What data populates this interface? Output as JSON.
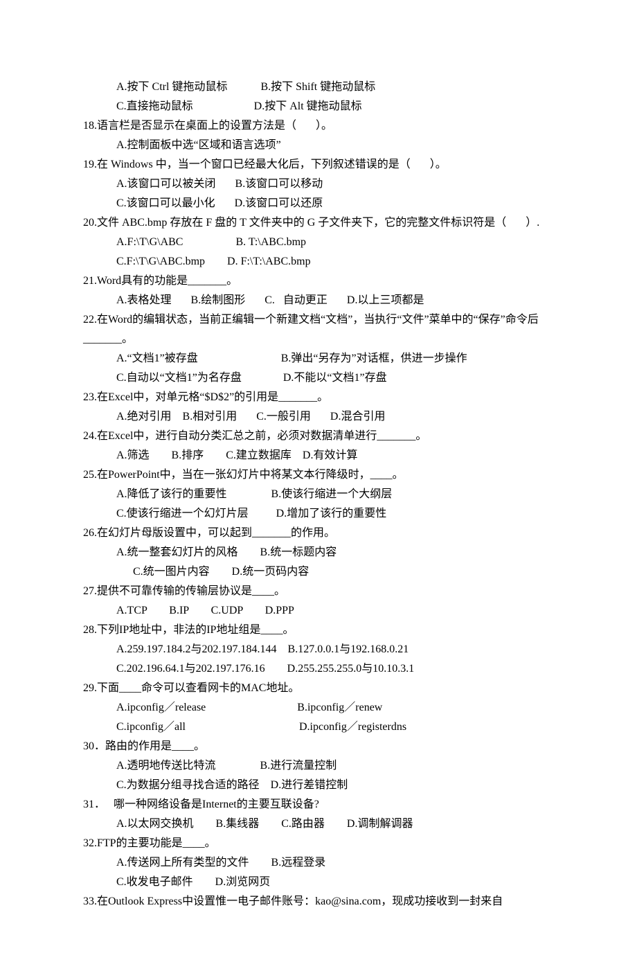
{
  "lines": [
    {
      "cls": "opt-indent",
      "text": "A.按下 Ctrl 键拖动鼠标            B.按下 Shift 键拖动鼠标"
    },
    {
      "cls": "opt-indent",
      "text": "C.直接拖动鼠标                      D.按下 Alt 键拖动鼠标"
    },
    {
      "cls": "q-body",
      "text": "18.语言栏是否显示在桌面上的设置方法是（       ）。"
    },
    {
      "cls": "opt-indent",
      "text": "A.控制面板中选“区域和语言选项”"
    },
    {
      "cls": "q-body",
      "text": "19.在 Windows 中，当一个窗口已经最大化后，下列叙述错误的是（       ）。"
    },
    {
      "cls": "opt-indent",
      "text": "A.该窗口可以被关闭       B.该窗口可以移动"
    },
    {
      "cls": "opt-indent",
      "text": "C.该窗口可以最小化       D.该窗口可以还原"
    },
    {
      "cls": "q-body",
      "text": "20.文件 ABC.bmp 存放在 F 盘的 T 文件夹中的 G 子文件夹下，它的完整文件标识符是（       ）."
    },
    {
      "cls": "opt-indent",
      "text": "A.F:\\T\\G\\ABC                   B. T:\\ABC.bmp"
    },
    {
      "cls": "opt-indent",
      "text": "C.F:\\T\\G\\ABC.bmp        D. F:\\T:\\ABC.bmp"
    },
    {
      "cls": "q-body",
      "text": "21.Word具有的功能是_______。"
    },
    {
      "cls": "opt-indent",
      "text": "A.表格处理       B.绘制图形       C.   自动更正       D.以上三项都是"
    },
    {
      "cls": "q-body",
      "text": "22.在Word的编辑状态，当前正编辑一个新建文档“文档”，当执行“文件”菜单中的“保存”命令后_______。"
    },
    {
      "cls": "opt-indent",
      "text": "A.“文档1”被存盘                              B.弹出“另存为”对话框，供进一步操作"
    },
    {
      "cls": "opt-indent",
      "text": "C.自动以“文档1”为名存盘               D.不能以“文档1”存盘"
    },
    {
      "cls": "q-body",
      "text": "23.在Excel中，对单元格“$D$2”的引用是_______。"
    },
    {
      "cls": "opt-indent",
      "text": "A.绝对引用    B.相对引用       C.一般引用       D.混合引用"
    },
    {
      "cls": "q-body",
      "text": "24.在Excel中，进行自动分类汇总之前，必须对数据清单进行_______。"
    },
    {
      "cls": "opt-indent",
      "text": "A.筛选        B.排序        C.建立数据库    D.有效计算"
    },
    {
      "cls": "q-body",
      "text": "25.在PowerPoint中，当在一张幻灯片中将某文本行降级时，____。"
    },
    {
      "cls": "opt-indent",
      "text": "A.降低了该行的重要性                B.使该行缩进一个大纲层"
    },
    {
      "cls": "opt-indent",
      "text": "C.使该行缩进一个幻灯片层          D.增加了该行的重要性"
    },
    {
      "cls": "q-body",
      "text": "26.在幻灯片母版设置中，可以起到_______的作用。"
    },
    {
      "cls": "opt-indent",
      "text": "A.统一整套幻灯片的风格        B.统一标题内容"
    },
    {
      "cls": "opt-indent-2",
      "text": "C.统一图片内容        D.统一页码内容"
    },
    {
      "cls": "q-body",
      "text": "27.提供不可靠传输的传输层协议是____。"
    },
    {
      "cls": "opt-indent",
      "text": "A.TCP        B.IP        C.UDP        D.PPP"
    },
    {
      "cls": "q-body",
      "text": "28.下列IP地址中，非法的IP地址组是____。"
    },
    {
      "cls": "opt-indent",
      "text": "A.259.197.184.2与202.197.184.144    B.127.0.0.1与192.168.0.21"
    },
    {
      "cls": "opt-indent",
      "text": "C.202.196.64.1与202.197.176.16        D.255.255.255.0与10.10.3.1"
    },
    {
      "cls": "q-body",
      "text": "29.下面____命令可以查看网卡的MAC地址。"
    },
    {
      "cls": "opt-indent",
      "text": "A.ipconfig／release                                 B.ipconfig／renew"
    },
    {
      "cls": "opt-indent",
      "text": "C.ipconfig／all                                         D.ipconfig／registerdns"
    },
    {
      "cls": "q-body",
      "text": "30．路由的作用是____。"
    },
    {
      "cls": "opt-indent",
      "text": "A.透明地传送比特流                B.进行流量控制"
    },
    {
      "cls": "opt-indent",
      "text": "C.为数据分组寻找合适的路径    D.进行差错控制"
    },
    {
      "cls": "q-body",
      "text": "31．   哪一种网络设备是Internet的主要互联设备?"
    },
    {
      "cls": "opt-indent",
      "text": "A.以太网交换机        B.集线器        C.路由器        D.调制解调器"
    },
    {
      "cls": "q-body",
      "text": "32.FTP的主要功能是____。"
    },
    {
      "cls": "opt-indent",
      "text": "A.传送网上所有类型的文件        B.远程登录"
    },
    {
      "cls": "opt-indent",
      "text": "C.收发电子邮件        D.浏览网页"
    },
    {
      "cls": "q-body",
      "text": "33.在Outlook Express中设置惟一电子邮件账号：kao@sina.com，现成功接收到一封来自"
    }
  ]
}
